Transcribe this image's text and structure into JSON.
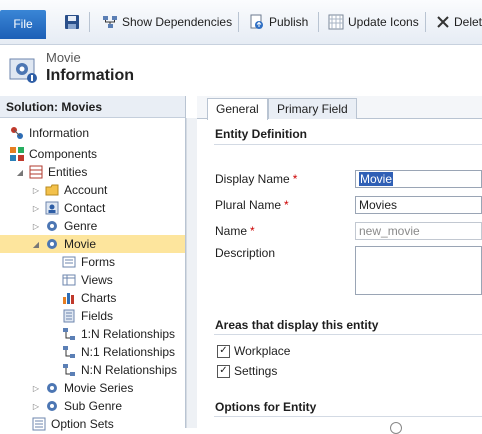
{
  "toolbar": {
    "file_label": "File",
    "show_dependencies_label": "Show Dependencies",
    "publish_label": "Publish",
    "update_icons_label": "Update Icons",
    "delete_label": "Delet"
  },
  "header": {
    "entity_type": "Movie",
    "title": "Information"
  },
  "nav": {
    "solution_label": "Solution: Movies",
    "items": [
      {
        "label": "Information"
      },
      {
        "label": "Components"
      },
      {
        "label": "Entities"
      },
      {
        "label": "Account"
      },
      {
        "label": "Contact"
      },
      {
        "label": "Genre"
      },
      {
        "label": "Movie"
      },
      {
        "label": "Forms"
      },
      {
        "label": "Views"
      },
      {
        "label": "Charts"
      },
      {
        "label": "Fields"
      },
      {
        "label": "1:N Relationships"
      },
      {
        "label": "N:1 Relationships"
      },
      {
        "label": "N:N Relationships"
      },
      {
        "label": "Movie Series"
      },
      {
        "label": "Sub Genre"
      },
      {
        "label": "Option Sets"
      }
    ]
  },
  "tabs": {
    "general": "General",
    "primary_field": "Primary Field"
  },
  "form": {
    "entity_definition_heading": "Entity Definition",
    "display_name_label": "Display Name",
    "display_name_value": "Movie",
    "plural_name_label": "Plural Name",
    "plural_name_value": "Movies",
    "name_label": "Name",
    "name_value": "new_movie",
    "description_label": "Description",
    "required_mark": "*",
    "areas_heading": "Areas that display this entity",
    "workplace_label": "Workplace",
    "settings_label": "Settings",
    "check_mark": "✓",
    "options_heading": "Options for Entity"
  },
  "colors": {
    "selected_row": "#fde59d",
    "file_button": "#2a72c8",
    "required": "#cc0000"
  }
}
